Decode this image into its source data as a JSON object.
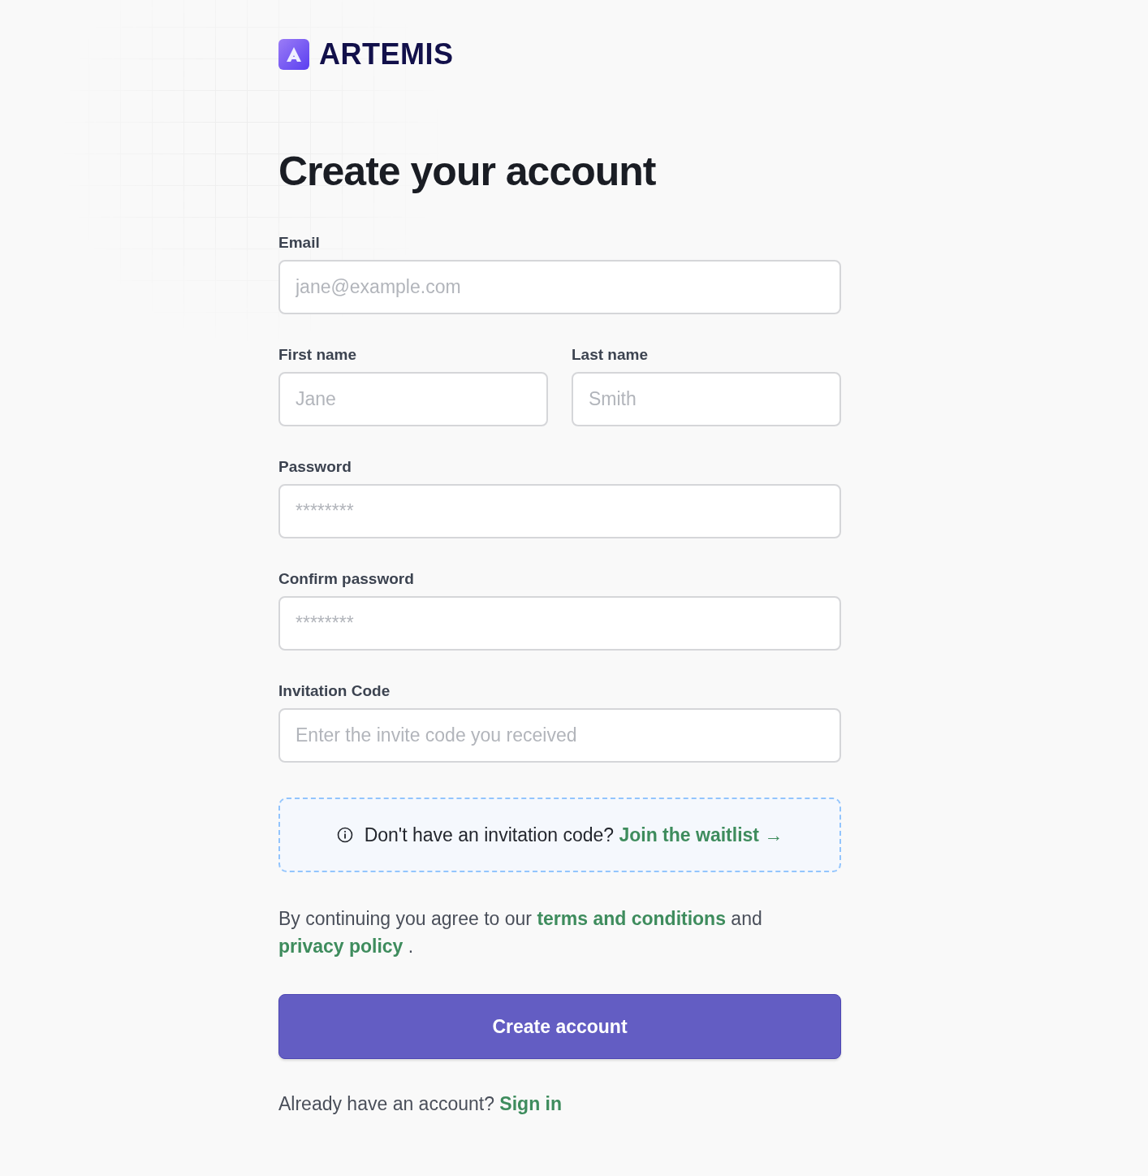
{
  "brand": {
    "name": "ARTEMIS"
  },
  "heading": "Create your account",
  "rows": [
    [
      {
        "label": "Email",
        "placeholder": "jane@example.com"
      }
    ],
    [
      {
        "label": "First name",
        "placeholder": "Jane"
      },
      {
        "label": "Last name",
        "placeholder": "Smith"
      }
    ],
    [
      {
        "label": "Password",
        "placeholder": "********"
      }
    ],
    [
      {
        "label": "Confirm password",
        "placeholder": "********"
      }
    ],
    [
      {
        "label": "Invitation Code",
        "placeholder": "Enter the invite code you received"
      }
    ]
  ],
  "waitlist": {
    "text": "Don't have an invitation code?",
    "link": "Join the waitlist →"
  },
  "terms": {
    "before": "By continuing you agree to our",
    "link1": "terms and conditions",
    "middle": "and",
    "link2": "privacy policy",
    "after": "."
  },
  "submit": "Create account",
  "signin": {
    "text": "Already have an account?",
    "link": "Sign in"
  }
}
